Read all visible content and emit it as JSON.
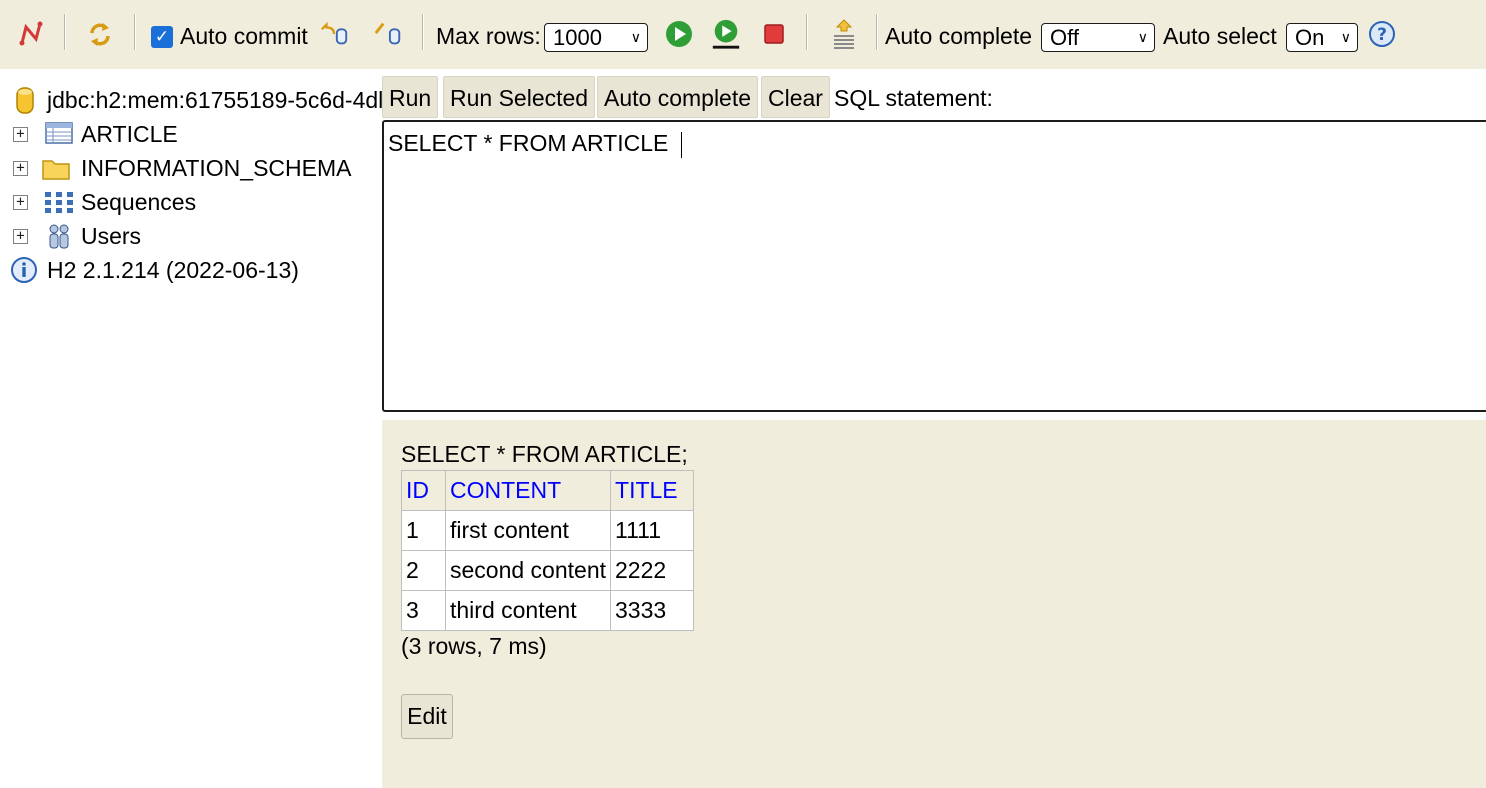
{
  "toolbar": {
    "auto_commit_label": "Auto commit",
    "auto_commit_checked": true,
    "max_rows_label": "Max rows:",
    "max_rows_value": "1000",
    "auto_complete_label": "Auto complete",
    "auto_complete_value": "Off",
    "auto_select_label": "Auto select",
    "auto_select_value": "On",
    "icons": [
      "disconnect-icon",
      "refresh-icon",
      "rollback-icon",
      "commit-icon",
      "run-icon",
      "run-selected-icon",
      "stop-icon",
      "history-icon",
      "help-icon"
    ]
  },
  "tree": {
    "connection": "jdbc:h2:mem:61755189-5c6d-4dl",
    "items": [
      {
        "label": "ARTICLE",
        "icon": "table-icon"
      },
      {
        "label": "INFORMATION_SCHEMA",
        "icon": "folder-icon"
      },
      {
        "label": "Sequences",
        "icon": "sequences-icon"
      },
      {
        "label": "Users",
        "icon": "users-icon"
      }
    ],
    "version": "H2 2.1.214 (2022-06-13)"
  },
  "sql_buttons": {
    "run": "Run",
    "run_selected": "Run Selected",
    "auto_complete": "Auto complete",
    "clear": "Clear",
    "statement_label": "SQL statement:"
  },
  "editor": {
    "text": "SELECT * FROM ARTICLE "
  },
  "results": {
    "query": "SELECT * FROM ARTICLE;",
    "columns": [
      "ID",
      "CONTENT",
      "TITLE"
    ],
    "rows": [
      [
        "1",
        "first content",
        "1111"
      ],
      [
        "2",
        "second content",
        "2222"
      ],
      [
        "3",
        "third content",
        "3333"
      ]
    ],
    "status": "(3 rows, 7 ms)",
    "edit_label": "Edit"
  },
  "colors": {
    "panel_bg": "#f1eddd",
    "header_link": "#0000ff",
    "checkbox_accent": "#1a6fd9"
  }
}
